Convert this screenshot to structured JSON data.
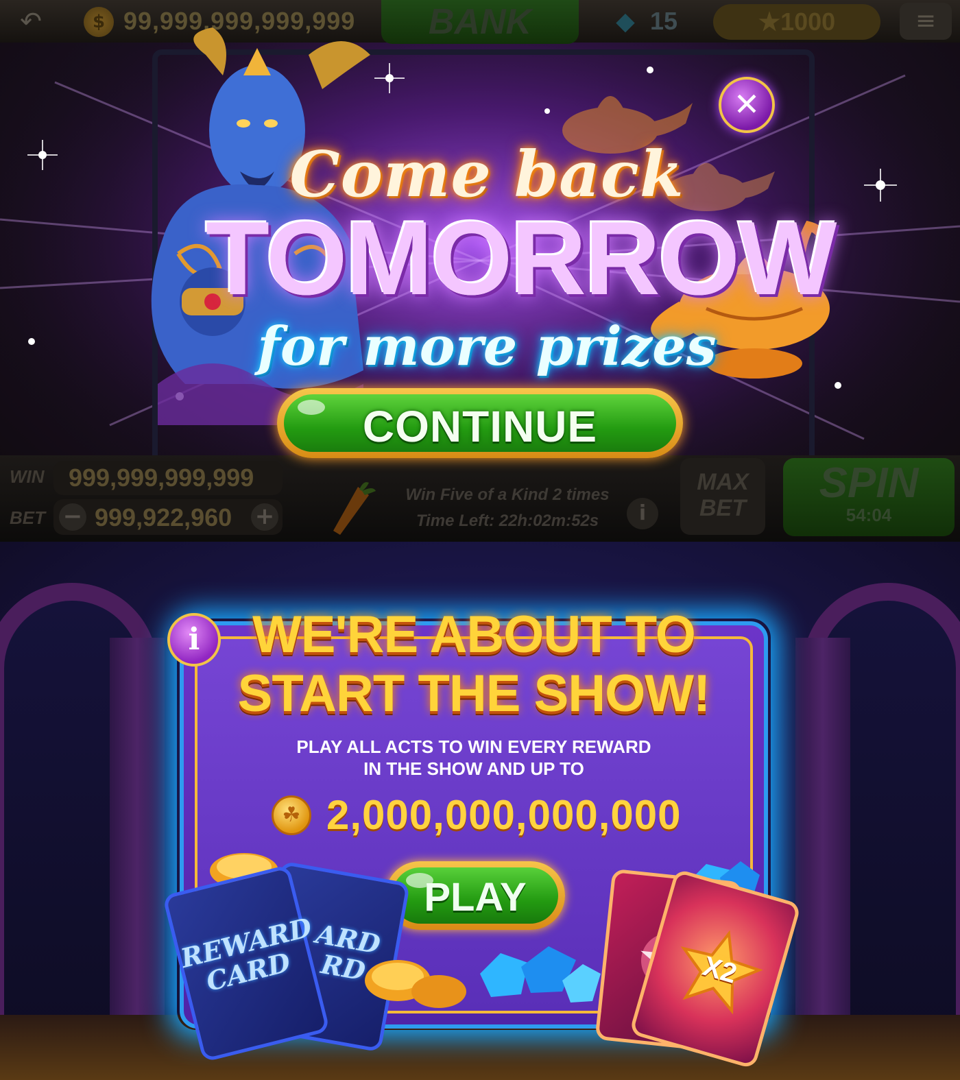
{
  "top_screen": {
    "top_bar": {
      "back_icon": "back-arrow-icon",
      "coin_icon": "$",
      "balance": "99,999,999,999,999",
      "bank_label": "BANK",
      "gems": "15",
      "stars": "★1000",
      "menu_icon": "≡"
    },
    "popup": {
      "line1": "Come back",
      "line2": "TOMORROW",
      "line3": "for more prizes",
      "continue_label": "CONTINUE",
      "close_symbol": "✕"
    },
    "bottom_bar": {
      "win_label": "WIN",
      "win_value": "999,999,999,999",
      "bet_label": "BET",
      "bet_minus": "−",
      "bet_value": "999,922,960",
      "bet_plus": "+",
      "quest_line1": "Win Five of a Kind 2 times",
      "quest_line2": "Time Left: 22h:02m:52s",
      "info_symbol": "i",
      "max_bet_line1": "MAX",
      "max_bet_line2": "BET",
      "spin_label": "SPIN",
      "spin_timer": "54:04"
    }
  },
  "bottom_screen": {
    "info_symbol": "i",
    "title_line1": "WE'RE ABOUT TO",
    "title_line2": "START THE SHOW!",
    "subtitle_line1": "PLAY ALL ACTS TO WIN EVERY REWARD",
    "subtitle_line2": "IN THE SHOW AND UP TO",
    "amount": "2,000,000,000,000",
    "coin_symbol": "☘",
    "play_label": "PLAY",
    "reward_card_text": "REWARD CARD",
    "reward_card_back_text": "ARD RD",
    "multiplier_label": "X2"
  },
  "colors": {
    "accent_gold": "#ffd43a",
    "button_green": "#239b11",
    "popup_purple": "#7c1aa8",
    "panel_blue_glow": "#1aa9ff"
  }
}
